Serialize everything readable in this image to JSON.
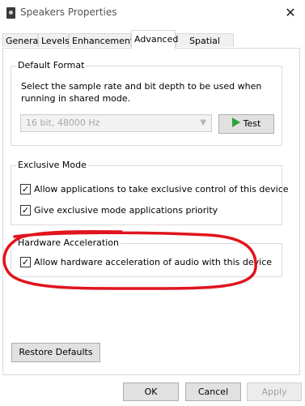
{
  "window": {
    "title": "Speakers Properties",
    "close_glyph": "✕"
  },
  "tabs": [
    {
      "label": "General"
    },
    {
      "label": "Levels"
    },
    {
      "label": "Enhancements"
    },
    {
      "label": "Advanced",
      "active": true
    },
    {
      "label": "Spatial sound"
    }
  ],
  "default_format": {
    "title": "Default Format",
    "description": "Select the sample rate and bit depth to be used when running in shared mode.",
    "format_value": "16 bit, 48000 Hz",
    "test_label": "Test"
  },
  "exclusive_mode": {
    "title": "Exclusive Mode",
    "options": [
      {
        "label": "Allow applications to take exclusive control of this device",
        "checked": true
      },
      {
        "label": "Give exclusive mode applications priority",
        "checked": true
      }
    ]
  },
  "hardware_acceleration": {
    "title": "Hardware Acceleration",
    "option": {
      "label": "Allow hardware acceleration of audio with this device",
      "checked": true
    }
  },
  "restore_defaults_label": "Restore Defaults",
  "footer": {
    "ok": "OK",
    "cancel": "Cancel",
    "apply": "Apply"
  },
  "colors": {
    "annotation_red": "#e0141e",
    "play_green": "#2aa43a"
  },
  "icons": {
    "window": "speaker-icon",
    "test": "play-icon",
    "dropdown": "chevron-down-icon",
    "check": "checkmark-icon"
  }
}
